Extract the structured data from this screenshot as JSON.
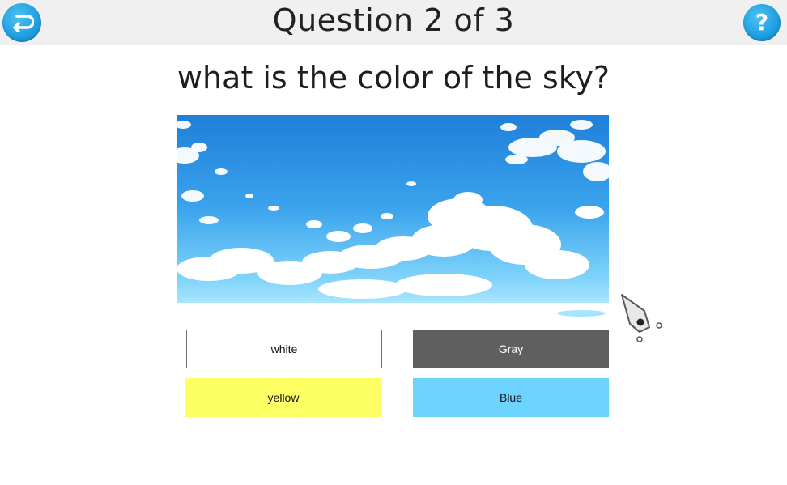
{
  "header": {
    "title": "Question 2 of 3",
    "back_icon": "back-arrow-icon",
    "help_icon": "help-icon",
    "help_label": "?"
  },
  "question": {
    "text": "what is the color of the sky?",
    "image": "sky-with-clouds-image"
  },
  "answers": [
    {
      "label": "white",
      "color": "#ffffff"
    },
    {
      "label": "Gray",
      "color": "#5f5f5f"
    },
    {
      "label": "yellow",
      "color": "#fdff62"
    },
    {
      "label": "Blue",
      "color": "#6cd2ff"
    }
  ],
  "colors": {
    "accent": "#1d9ee0",
    "header_bg": "#f0f0f0"
  }
}
